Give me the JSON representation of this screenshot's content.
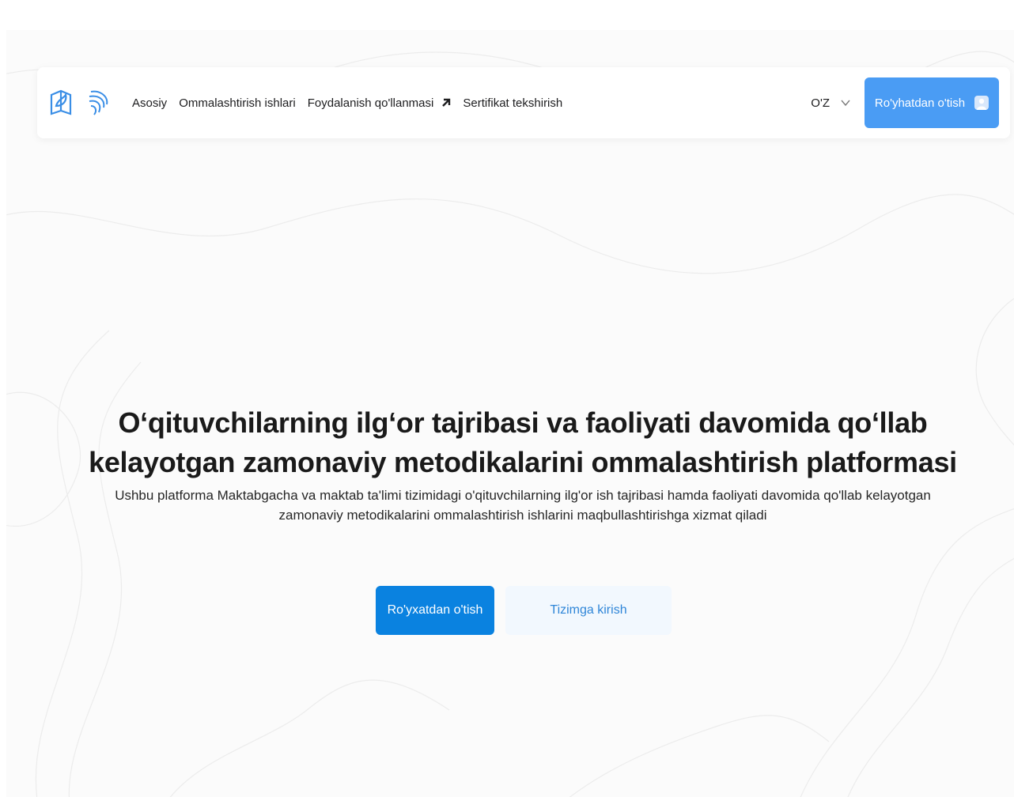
{
  "navbar": {
    "logos": [
      "book-leaf-logo-icon",
      "swirl-emblem-logo-icon"
    ],
    "links": [
      {
        "label": "Asosiy"
      },
      {
        "label": "Ommalashtirish ishlari"
      },
      {
        "label": "Foydalanish qo'llanmasi",
        "icon": "external-arrow-icon"
      },
      {
        "label": "Sertifikat tekshirish"
      }
    ],
    "language": {
      "selected": "O'Z",
      "icon": "chevron-down-icon"
    },
    "register_button": {
      "label": "Ro'yhatdan o'tish",
      "icon": "user-icon"
    }
  },
  "hero": {
    "title": "O‘qituvchilarning ilg‘or tajribasi va faoliyati davomida qo‘llab kelayotgan zamonaviy metodikalarini ommalashtirish platformasi",
    "subtitle": "Ushbu platforma Maktabgacha va maktab ta'limi tizimidagi o'qituvchilarning ilg'or ish tajribasi hamda faoliyati davomida qo'llab kelayotgan zamonaviy metodikalarini ommalashtirish ishlarini maqbullashtirishga xizmat qiladi",
    "primary_button": "Ro'yxatdan o'tish",
    "secondary_button": "Tizimga kirish"
  },
  "colors": {
    "accent": "#4a9cf4",
    "primary_button": "#0a82e0",
    "secondary_button_bg": "#f2f8fe",
    "secondary_button_text": "#2f86d8",
    "logo_blue": "#3a8ee6"
  }
}
